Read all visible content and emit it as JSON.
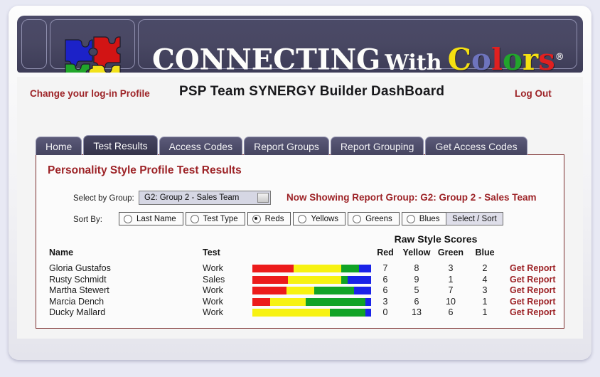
{
  "brand": {
    "logo_icon": "puzzle-pieces-icon",
    "word1": "CONNECTING",
    "word2": "With",
    "colors_word": "Colors",
    "registered_mark": "®",
    "colors_letters": [
      {
        "char": "C",
        "color": "#f5e111"
      },
      {
        "char": "o",
        "color": "#6e74bd"
      },
      {
        "char": "l",
        "color": "#e02020"
      },
      {
        "char": "o",
        "color": "#22a52c"
      },
      {
        "char": "r",
        "color": "#f5e111"
      },
      {
        "char": "s",
        "color": "#e02020"
      }
    ]
  },
  "header": {
    "change_profile_link": "Change your log-in Profile",
    "title": "PSP Team SYNERGY Builder DashBoard",
    "logout_link": "Log Out"
  },
  "tabs": [
    {
      "label": "Home",
      "active": false
    },
    {
      "label": "Test Results",
      "active": true
    },
    {
      "label": "Access Codes",
      "active": false
    },
    {
      "label": "Report Groups",
      "active": false
    },
    {
      "label": "Report Grouping",
      "active": false
    },
    {
      "label": "Get Access Codes",
      "active": false
    }
  ],
  "panel": {
    "title": "Personality Style Profile Test Results",
    "select_by_group_label": "Select by Group:",
    "group_select_value": "G2: Group 2 - Sales Team",
    "now_showing": "Now Showing Report Group: G2: Group 2 - Sales Team",
    "sort_by_label": "Sort By:",
    "sort_options": [
      {
        "label": "Last Name",
        "checked": false
      },
      {
        "label": "Test Type",
        "checked": false
      },
      {
        "label": "Reds",
        "checked": true
      },
      {
        "label": "Yellows",
        "checked": false
      },
      {
        "label": "Greens",
        "checked": false
      },
      {
        "label": "Blues",
        "checked": false
      }
    ],
    "sort_button": "Select / Sort"
  },
  "table": {
    "group_header": "Raw Style Scores",
    "columns": {
      "name": "Name",
      "test": "Test",
      "red": "Red",
      "yellow": "Yellow",
      "green": "Green",
      "blue": "Blue"
    },
    "report_link_label": "Get Report",
    "rows": [
      {
        "name": "Gloria Gustafos",
        "test": "Work",
        "red": 7,
        "yellow": 8,
        "green": 3,
        "blue": 2,
        "report": "Get Report"
      },
      {
        "name": "Rusty Schmidt",
        "test": "Sales",
        "red": 6,
        "yellow": 9,
        "green": 1,
        "blue": 4,
        "report": "Get Report"
      },
      {
        "name": "Martha Stewert",
        "test": "Work",
        "red": 6,
        "yellow": 5,
        "green": 7,
        "blue": 3,
        "report": "Get Report"
      },
      {
        "name": "Marcia Dench",
        "test": "Work",
        "red": 3,
        "yellow": 6,
        "green": 10,
        "blue": 1,
        "report": "Get Report"
      },
      {
        "name": "Ducky Mallard",
        "test": "Work",
        "red": 0,
        "yellow": 13,
        "green": 6,
        "blue": 1,
        "report": "Get Report"
      }
    ]
  },
  "colors": {
    "red": "#ec1b1b",
    "yellow": "#f7f212",
    "green": "#11a326",
    "blue": "#1a23e8",
    "accent_dark_red": "#9d2327",
    "banner_purple": "#494863"
  }
}
